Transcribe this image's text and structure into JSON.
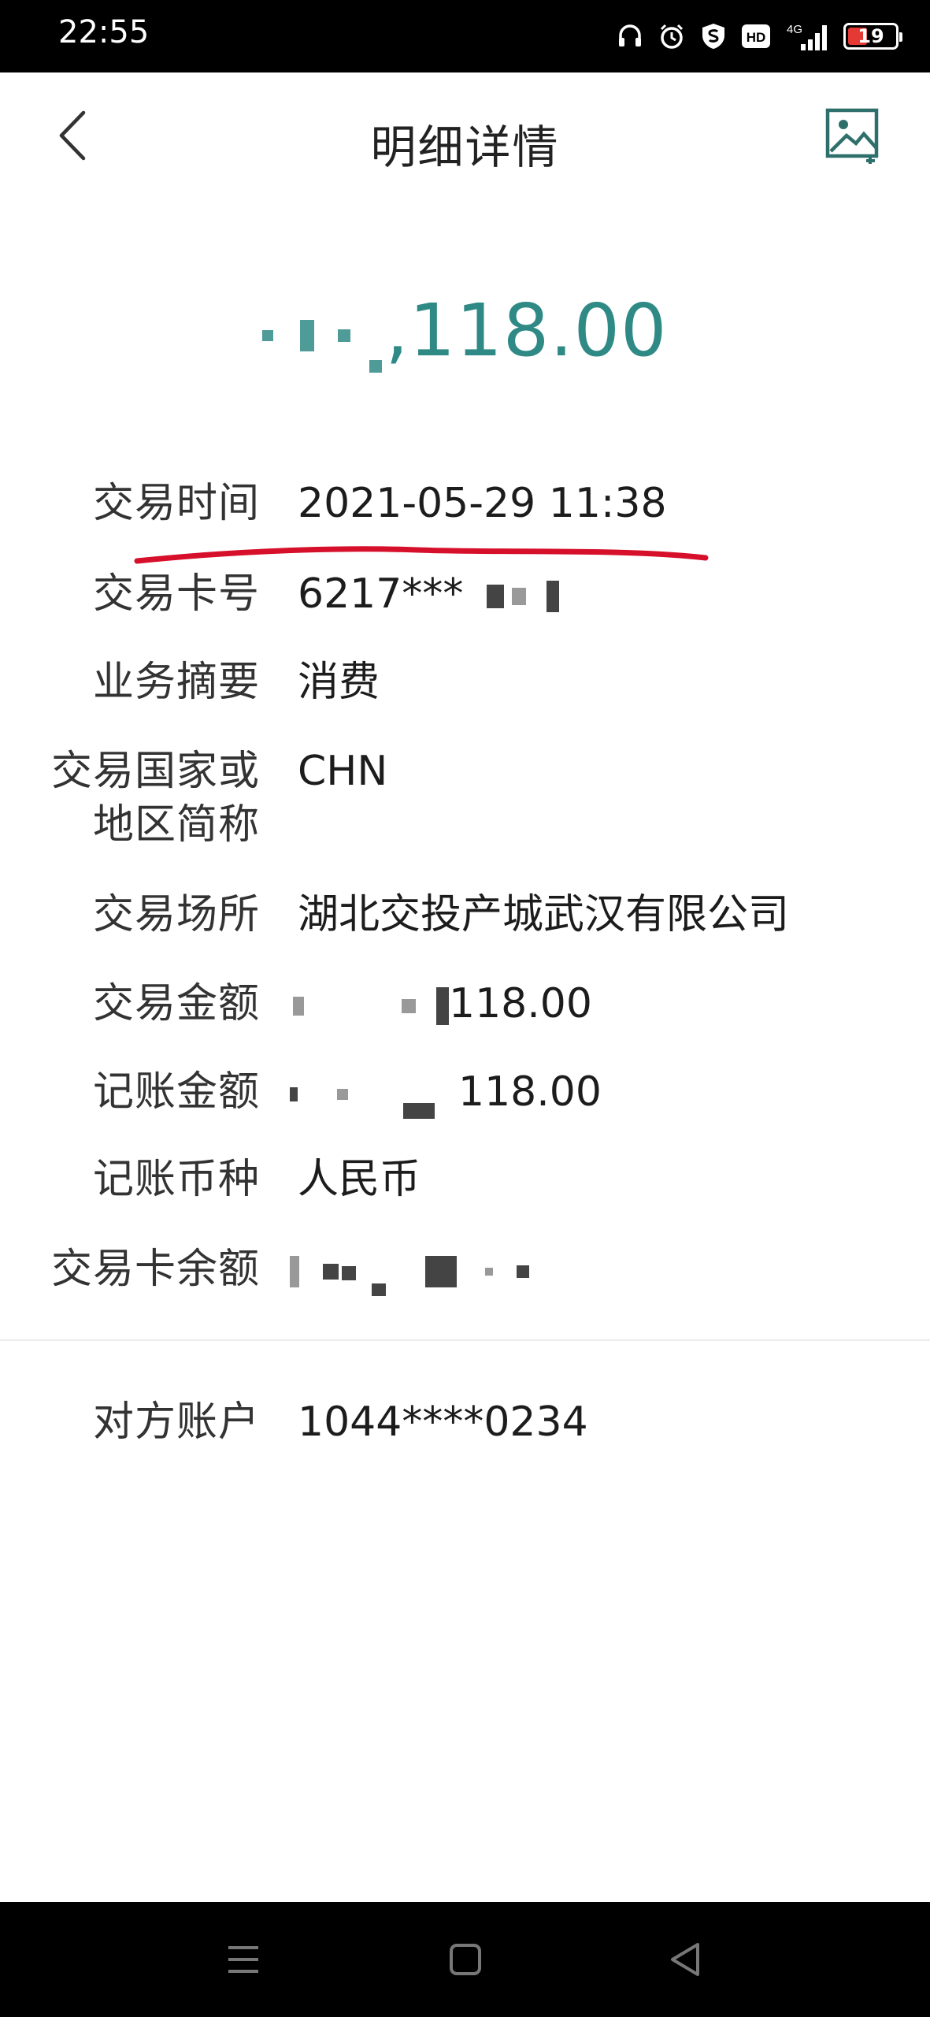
{
  "status_bar": {
    "time": "22:55",
    "network": "4G",
    "hd": "HD",
    "battery": "19"
  },
  "header": {
    "title": "明细详情"
  },
  "amount": {
    "visible_suffix": ",118.00"
  },
  "details": [
    {
      "label": "交易时间",
      "value": "2021-05-29 11:38"
    },
    {
      "label": "交易卡号",
      "value": "6217***"
    },
    {
      "label": "业务摘要",
      "value": "消费"
    },
    {
      "label": "交易国家或地区简称",
      "label_line1": "交易国家或",
      "label_line2": "地区简称",
      "value": "CHN"
    },
    {
      "label": "交易场所",
      "value": "湖北交投产城武汉有限公司"
    },
    {
      "label": "交易金额",
      "value": "118.00"
    },
    {
      "label": "记账金额",
      "value": "118.00"
    },
    {
      "label": "记账币种",
      "value": "人民币"
    },
    {
      "label": "交易卡余额",
      "value": ""
    }
  ],
  "counterparty": {
    "label": "对方账户",
    "value": "1044****0234"
  },
  "colors": {
    "amount": "#2f8a86",
    "annotation_line": "#d6102a",
    "status_bar": "#000000",
    "system_nav": "#000000"
  }
}
